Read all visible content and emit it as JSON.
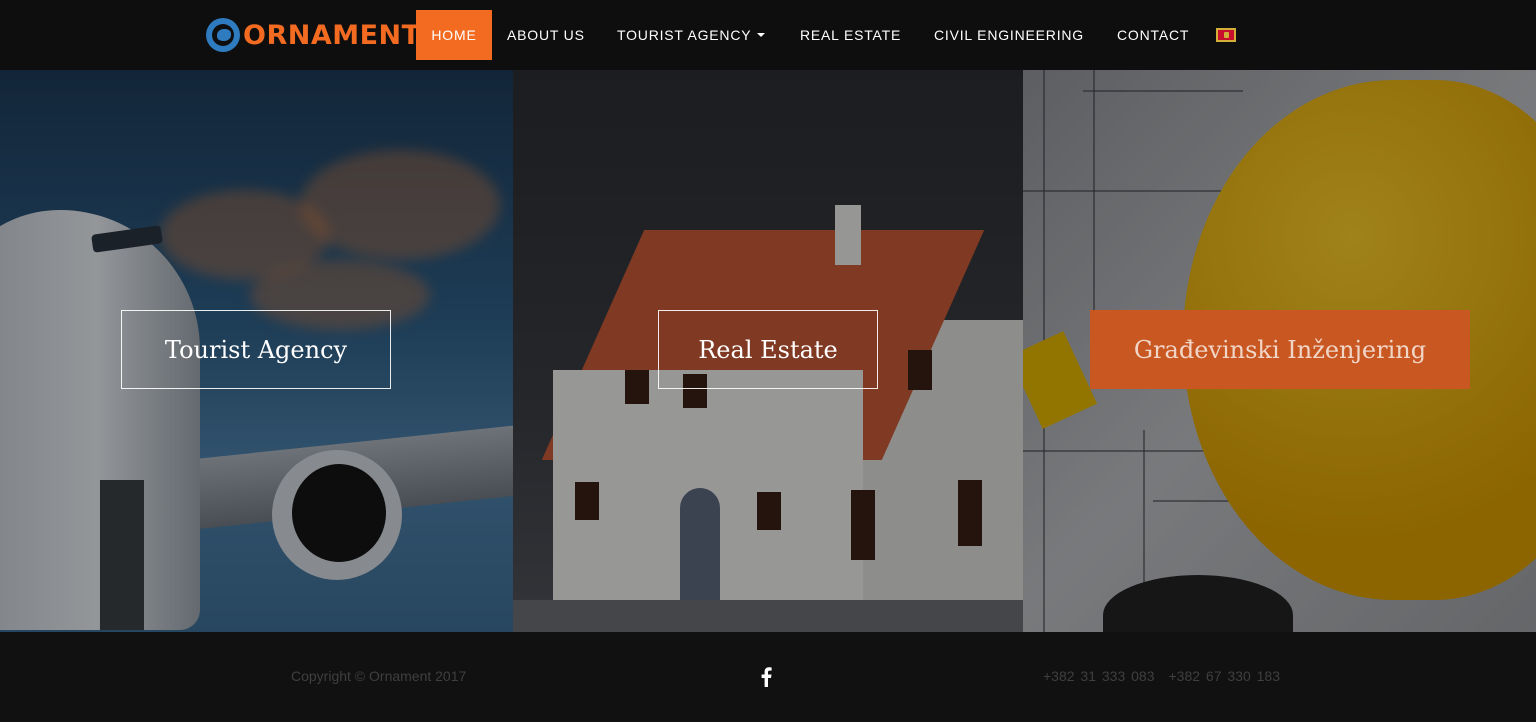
{
  "brand": {
    "logo_text": "ORNAMENT",
    "icon": "ornament-logo-icon",
    "colors": {
      "orange": "#f26b21",
      "blue": "#2f7bc0"
    }
  },
  "nav": {
    "items": [
      {
        "label": "HOME",
        "active": true
      },
      {
        "label": "ABOUT US"
      },
      {
        "label": "TOURIST AGENCY",
        "has_dropdown": true
      },
      {
        "label": "REAL ESTATE"
      },
      {
        "label": "CIVIL ENGINEERING"
      },
      {
        "label": "CONTACT"
      }
    ],
    "language_icon": "montenegro-flag-icon"
  },
  "hero": {
    "panels": [
      {
        "button_label": "Tourist Agency"
      },
      {
        "button_label": "Real Estate"
      },
      {
        "button_label": "Građevinski Inženjering",
        "highlighted": true
      }
    ]
  },
  "footer": {
    "copyright": "Copyright © Ornament 2017",
    "social_icon": "facebook-icon",
    "phones": [
      "+382 31 333 083",
      "+382 67 330 183"
    ]
  }
}
